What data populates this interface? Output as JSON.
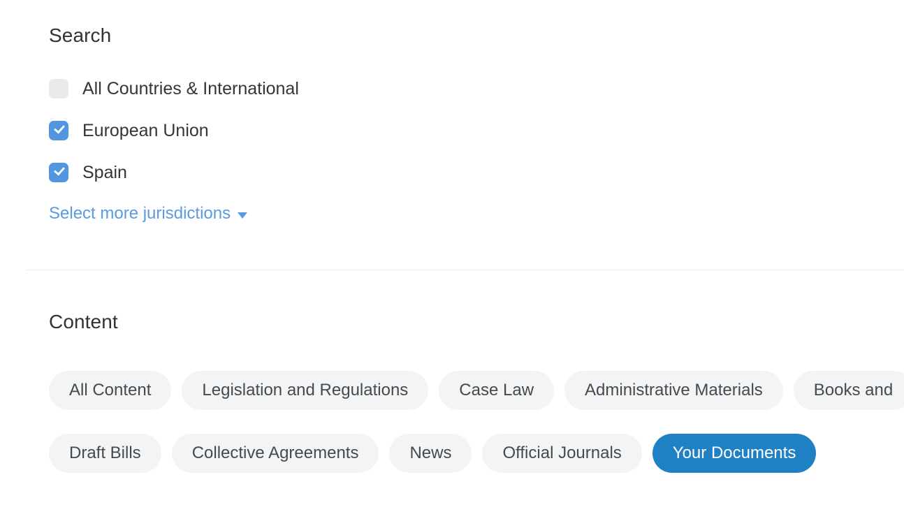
{
  "search": {
    "heading": "Search",
    "jurisdictions": [
      {
        "label": "All Countries & International",
        "checked": false
      },
      {
        "label": "European Union",
        "checked": true
      },
      {
        "label": "Spain",
        "checked": true
      }
    ],
    "select_more_label": "Select more jurisdictions",
    "select_more_icon": "caret-down-icon"
  },
  "content": {
    "heading": "Content",
    "rows": [
      [
        {
          "label": "All Content",
          "active": false
        },
        {
          "label": "Legislation and Regulations",
          "active": false
        },
        {
          "label": "Case Law",
          "active": false
        },
        {
          "label": "Administrative Materials",
          "active": false
        },
        {
          "label": "Books and",
          "active": false
        }
      ],
      [
        {
          "label": "Draft Bills",
          "active": false
        },
        {
          "label": "Collective Agreements",
          "active": false
        },
        {
          "label": "News",
          "active": false
        },
        {
          "label": "Official Journals",
          "active": false
        },
        {
          "label": "Your Documents",
          "active": true
        }
      ]
    ]
  },
  "colors": {
    "accent_blue": "#1f80c4",
    "checkbox_blue": "#5295e0",
    "link_blue": "#5a9ae0",
    "chip_bg": "#f3f4f5",
    "checkbox_off": "#e9eaeb",
    "divider": "#ededef",
    "text": "#333638"
  }
}
